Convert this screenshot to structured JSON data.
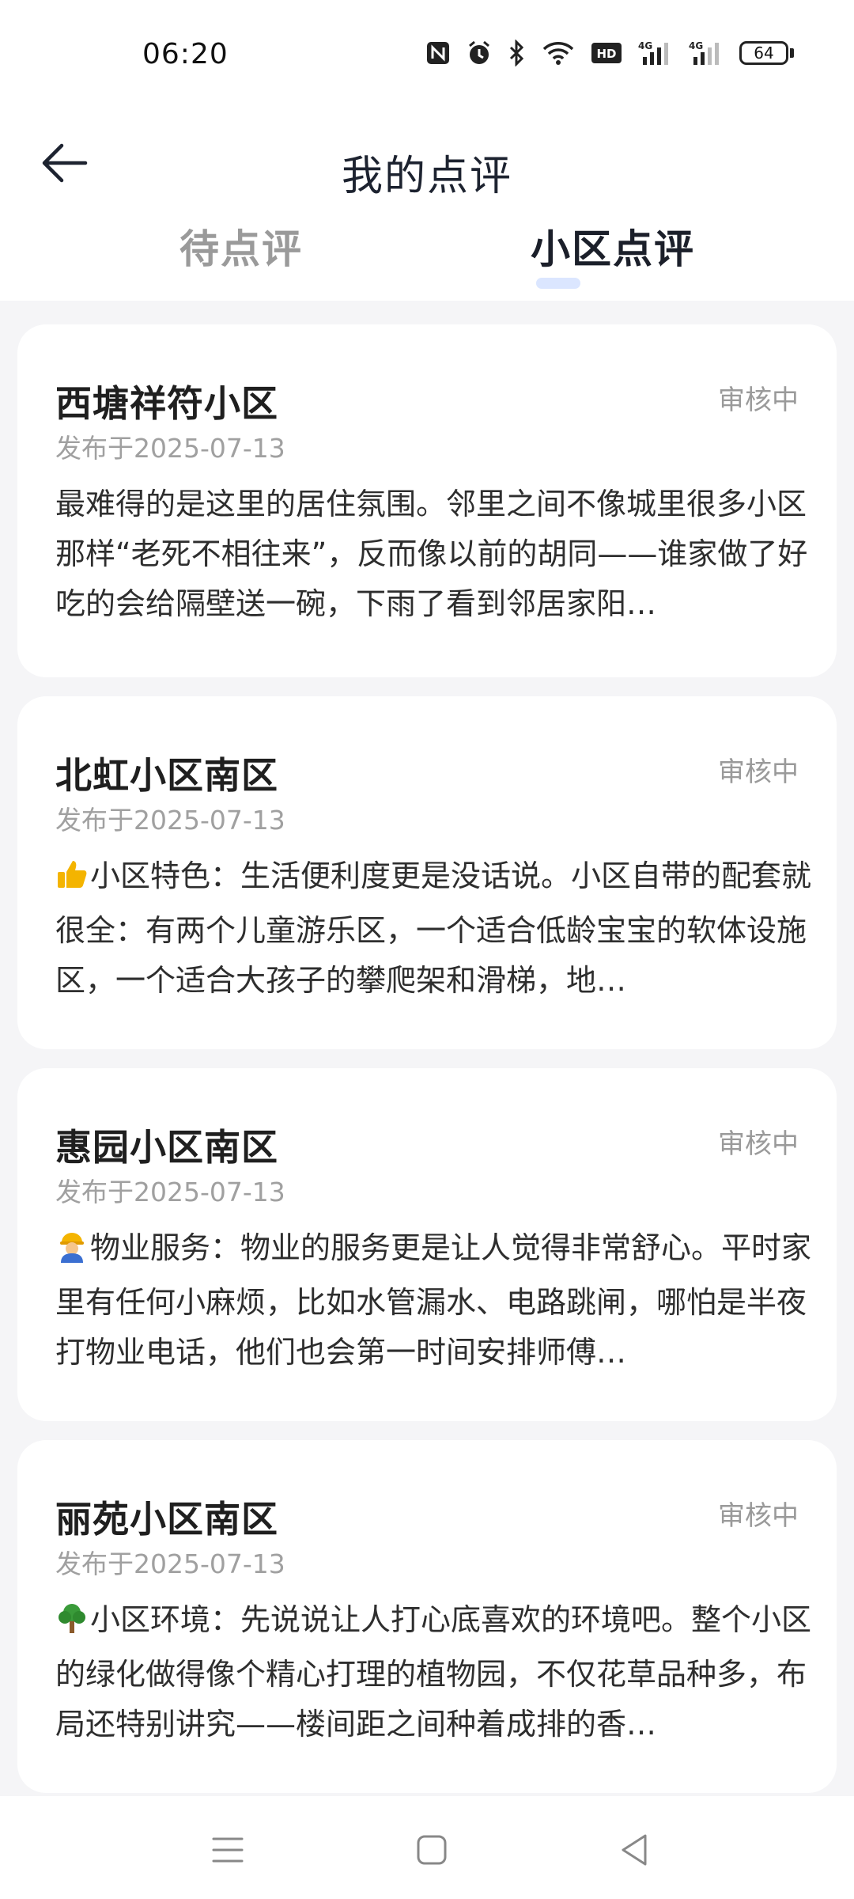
{
  "status_bar": {
    "time": "06:20",
    "battery": "64",
    "icons": [
      "nfc-icon",
      "alarm-icon",
      "bluetooth-icon",
      "wifi-icon",
      "hd-icon",
      "signal-4g-icon",
      "signal-4g-icon"
    ]
  },
  "header": {
    "title": "我的点评",
    "back_icon": "arrow-left-icon"
  },
  "tabs": [
    {
      "label": "待点评",
      "active": false
    },
    {
      "label": "小区点评",
      "active": true
    }
  ],
  "reviews": [
    {
      "title": "西塘祥符小区",
      "status": "审核中",
      "date": "发布于2025-07-13",
      "emoji": "",
      "text": "最难得的是这里的居住氛围。邻里之间不像城里很多小区那样“老死不相往来”，反而像以前的胡同——谁家做了好吃的会给隔壁送一碗，下雨了看到邻居家阳…"
    },
    {
      "title": "北虹小区南区",
      "status": "审核中",
      "date": "发布于2025-07-13",
      "emoji": "thumbs-up-icon",
      "text": "小区特色：生活便利度更是没话说。小区自带的配套就很全：有两个儿童游乐区，一个适合低龄宝宝的软体设施区，一个适合大孩子的攀爬架和滑梯，地…"
    },
    {
      "title": "惠园小区南区",
      "status": "审核中",
      "date": "发布于2025-07-13",
      "emoji": "worker-icon",
      "text": "物业服务：物业的服务更是让人觉得非常舒心。平时家里有任何小麻烦，比如水管漏水、电路跳闸，哪怕是半夜打物业电话，他们也会第一时间安排师傅…"
    },
    {
      "title": "丽苑小区南区",
      "status": "审核中",
      "date": "发布于2025-07-13",
      "emoji": "tree-icon",
      "text": "小区环境：先说说让人打心底喜欢的环境吧。整个小区的绿化做得像个精心打理的植物园，不仅花草品种多，布局还特别讲究——楼间距之间种着成排的香…"
    }
  ],
  "nav_bar": {
    "icons": [
      "menu-icon",
      "home-square-icon",
      "back-triangle-icon"
    ]
  },
  "colors": {
    "background": "#f5f5f7",
    "card": "#ffffff",
    "muted": "#9a9a9a",
    "tab_accent": "#dbe6ff"
  }
}
